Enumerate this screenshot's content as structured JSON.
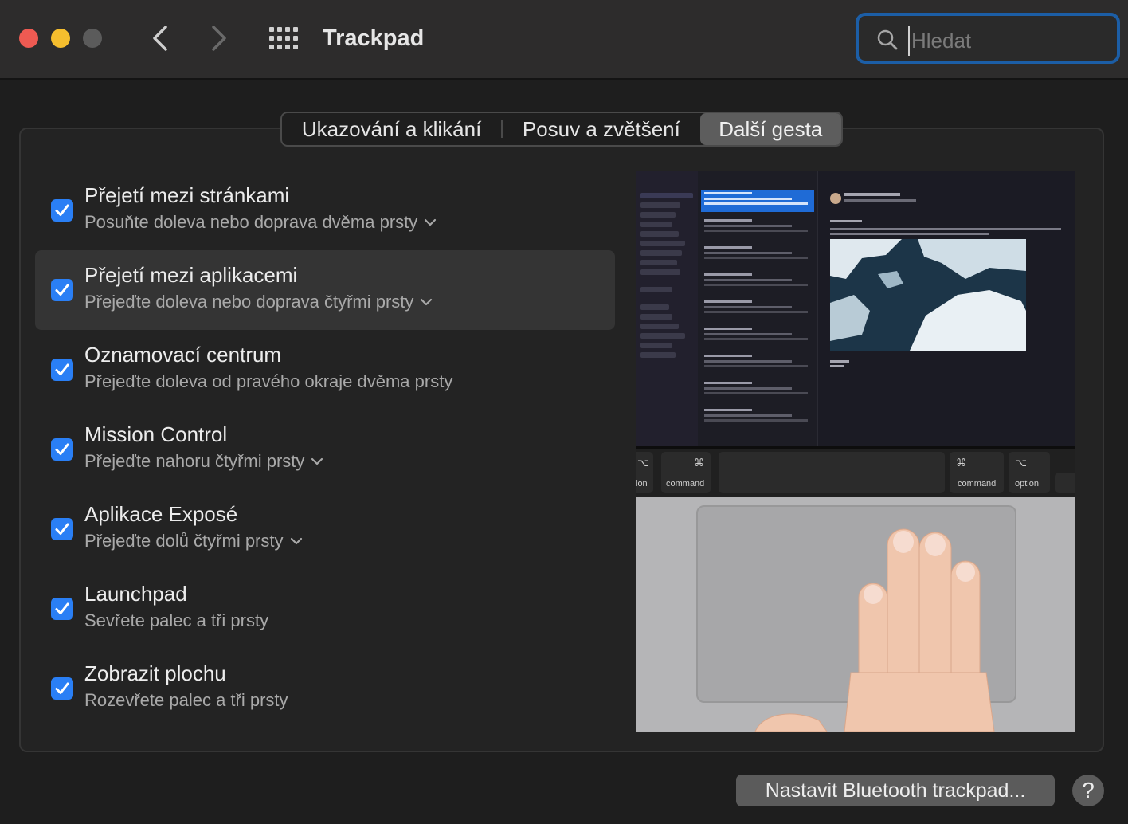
{
  "window": {
    "title": "Trackpad"
  },
  "search": {
    "placeholder": "Hledat"
  },
  "tabs": [
    {
      "label": "Ukazování a klikání"
    },
    {
      "label": "Posuv a zvětšení"
    },
    {
      "label": "Další gesta"
    }
  ],
  "gestures": [
    {
      "title": "Přejetí mezi stránkami",
      "subtitle": "Posuňte doleva nebo doprava dvěma prsty",
      "has_menu": true,
      "checked": true
    },
    {
      "title": "Přejetí mezi aplikacemi",
      "subtitle": "Přejeďte doleva nebo doprava čtyřmi prsty",
      "has_menu": true,
      "checked": true
    },
    {
      "title": "Oznamovací centrum",
      "subtitle": "Přejeďte doleva od pravého okraje dvěma prsty",
      "has_menu": false,
      "checked": true
    },
    {
      "title": "Mission Control",
      "subtitle": "Přejeďte nahoru čtyřmi prsty",
      "has_menu": true,
      "checked": true
    },
    {
      "title": "Aplikace Exposé",
      "subtitle": "Přejeďte dolů čtyřmi prsty",
      "has_menu": true,
      "checked": true
    },
    {
      "title": "Launchpad",
      "subtitle": "Sevřete palec a tři prsty",
      "has_menu": false,
      "checked": true
    },
    {
      "title": "Zobrazit plochu",
      "subtitle": "Rozevřete palec a tři prsty",
      "has_menu": false,
      "checked": true
    }
  ],
  "preview": {
    "keys": [
      {
        "symbol": "⌥",
        "label": "ion"
      },
      {
        "symbol": "⌘",
        "label": "command"
      },
      {
        "symbol": "⌘",
        "label": "command"
      },
      {
        "symbol": "⌥",
        "label": "option"
      }
    ]
  },
  "bottom": {
    "bluetooth_button": "Nastavit Bluetooth trackpad...",
    "help_label": "?"
  },
  "colors": {
    "accent": "#2a7ff5",
    "focus_ring": "#1c5ea6",
    "close": "#ee5a52",
    "minimize": "#f5be2e",
    "zoom_disabled": "#5b5b5b"
  }
}
